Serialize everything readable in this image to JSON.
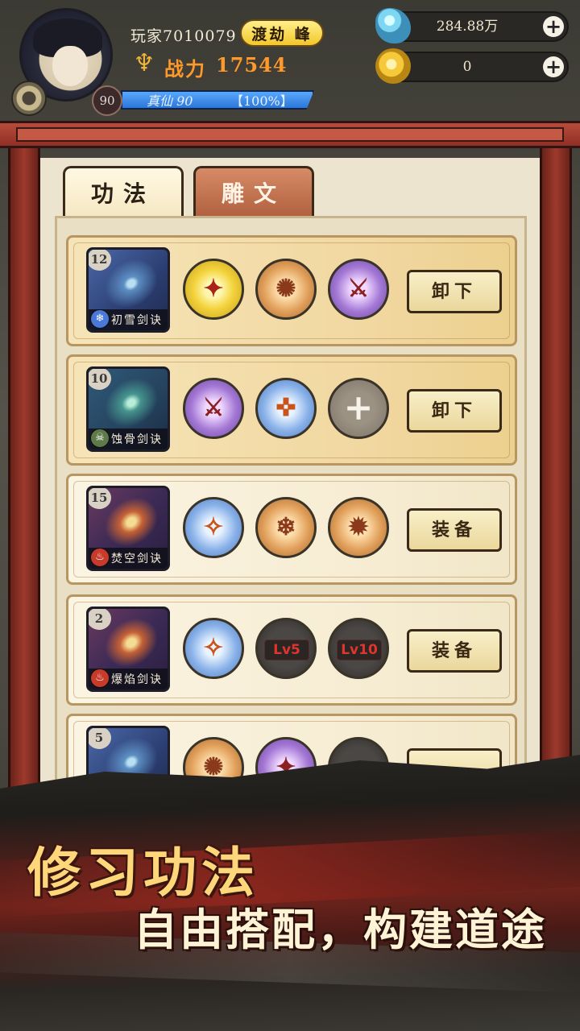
{
  "player": {
    "name": "玩家7010079",
    "realm_badge": "渡劫 峰",
    "power_label": "战力",
    "power_value": "17544",
    "level": "90",
    "cultivation_realm": "真仙 90",
    "cultivation_progress_text": "【100%】",
    "cultivation_progress": 1.0
  },
  "resources": [
    {
      "icon": "spirit-stone-icon",
      "value": "284.88万"
    },
    {
      "icon": "gold-coin-icon",
      "value": "0"
    }
  ],
  "tabs": [
    {
      "label": "功法",
      "active": true
    },
    {
      "label": "雕文",
      "active": false
    }
  ],
  "techniques": [
    {
      "level": "12",
      "name": "初雪剑诀",
      "element": "frost",
      "element_icon": "snowflake-icon",
      "sockets": [
        {
          "type": "gold",
          "icon": "sword-burst-icon"
        },
        {
          "type": "bronze",
          "icon": "whirl-blade-icon"
        },
        {
          "type": "purple",
          "icon": "triple-swords-icon"
        }
      ],
      "action": "卸下",
      "equipped": true
    },
    {
      "level": "10",
      "name": "蚀骨剑诀",
      "element": "poison",
      "element_icon": "skull-icon",
      "sockets": [
        {
          "type": "purple",
          "icon": "triple-swords-icon"
        },
        {
          "type": "blue",
          "icon": "flame-sword-icon"
        },
        {
          "type": "empty",
          "icon": "plus-icon"
        }
      ],
      "action": "卸下",
      "equipped": true
    },
    {
      "level": "15",
      "name": "焚空剑诀",
      "element": "fire",
      "element_icon": "flame-icon",
      "sockets": [
        {
          "type": "blue",
          "icon": "ice-sword-icon"
        },
        {
          "type": "bronze",
          "icon": "snow-crystal-icon"
        },
        {
          "type": "bronze",
          "icon": "shattered-sword-icon"
        }
      ],
      "action": "装备",
      "equipped": false
    },
    {
      "level": "2",
      "name": "爆焰剑诀",
      "element": "fire",
      "element_icon": "flame-icon",
      "sockets": [
        {
          "type": "blue",
          "icon": "ice-sword-icon"
        },
        {
          "type": "locked",
          "label": "Lv5"
        },
        {
          "type": "locked",
          "label": "Lv10"
        }
      ],
      "action": "装备",
      "equipped": false
    },
    {
      "level": "5",
      "name": "",
      "element": "frost",
      "element_icon": "snowflake-icon",
      "sockets": [
        {
          "type": "bronze",
          "icon": "whirl-icon"
        },
        {
          "type": "purple",
          "icon": "crimson-burst-icon"
        },
        {
          "type": "locked",
          "label": ""
        }
      ],
      "action": "",
      "equipped": false
    }
  ],
  "slogan": {
    "line1": "修习功法",
    "line2": "自由搭配，构建道途"
  },
  "colors": {
    "frame_red": "#9c3a2c",
    "power_orange": "#ff9a2a",
    "realm_gold": "#f2c72c",
    "xp_blue": "#2c76d8"
  }
}
